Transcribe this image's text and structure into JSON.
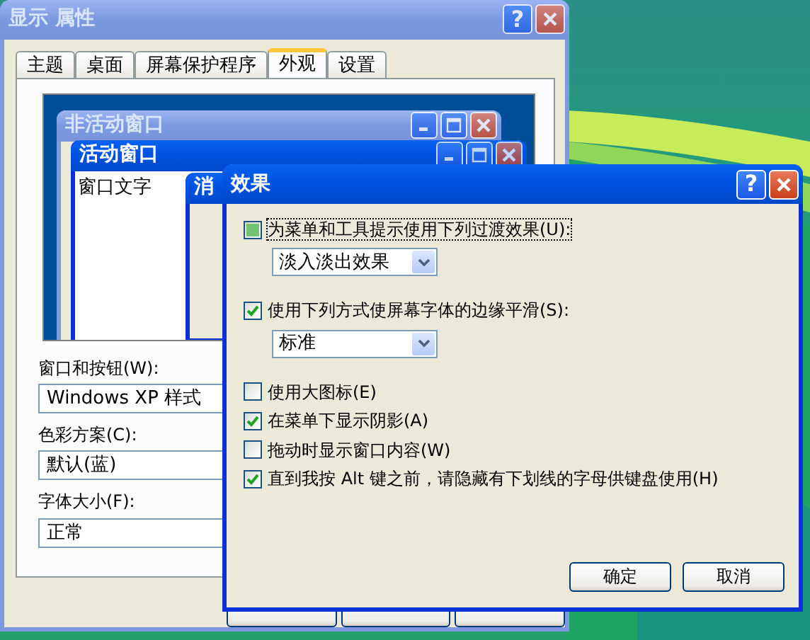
{
  "display_window": {
    "title": "显示 属性",
    "active": false,
    "help": "?",
    "tabs": [
      {
        "label": "主题",
        "selected": false
      },
      {
        "label": "桌面",
        "selected": false
      },
      {
        "label": "屏幕保护程序",
        "selected": false
      },
      {
        "label": "外观",
        "selected": true
      },
      {
        "label": "设置",
        "selected": false
      }
    ],
    "preview": {
      "inactive_window": {
        "title": "非活动窗口"
      },
      "active_window": {
        "title": "活动窗口",
        "text": "窗口文字"
      },
      "message_box": {
        "title": "消"
      }
    },
    "fields": [
      {
        "label": "窗口和按钮(W):",
        "value": "Windows XP 样式"
      },
      {
        "label": "色彩方案(C):",
        "value": "默认(蓝)"
      },
      {
        "label": "字体大小(F):",
        "value": "正常"
      }
    ]
  },
  "effects_dialog": {
    "title": "效果",
    "active": true,
    "help": "?",
    "options": [
      {
        "kind": "checkbox",
        "label": "为菜单和工具提示使用下列过渡效果(U):",
        "checked": false,
        "indeterminate": true
      },
      {
        "kind": "select",
        "value": "淡入淡出效果"
      },
      {
        "kind": "checkbox",
        "label": "使用下列方式使屏幕字体的边缘平滑(S):",
        "checked": true,
        "indeterminate": false
      },
      {
        "kind": "select",
        "value": "标准"
      },
      {
        "kind": "checkbox",
        "label": "使用大图标(E)",
        "checked": false,
        "indeterminate": false
      },
      {
        "kind": "checkbox",
        "label": "在菜单下显示阴影(A)",
        "checked": true,
        "indeterminate": false
      },
      {
        "kind": "checkbox",
        "label": "拖动时显示窗口内容(W)",
        "checked": false,
        "indeterminate": false
      },
      {
        "kind": "checkbox",
        "label": "直到我按 Alt 键之前，请隐藏有下划线的字母供键盘使用(H)",
        "checked": true,
        "indeterminate": false
      }
    ],
    "buttons": [
      "确定",
      "取消"
    ]
  }
}
